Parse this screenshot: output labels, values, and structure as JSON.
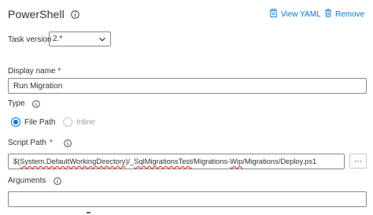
{
  "header": {
    "title": "PowerShell",
    "view_yaml": "View YAML",
    "remove": "Remove"
  },
  "task_version": {
    "label": "Task version",
    "value": "2.*"
  },
  "display_name": {
    "label": "Display name",
    "required_marker": "*",
    "value": "Run Migration"
  },
  "type": {
    "label": "Type",
    "options": [
      {
        "label": "File Path",
        "selected": true
      },
      {
        "label": "Inline",
        "selected": false
      }
    ]
  },
  "script_path": {
    "label": "Script Path",
    "required_marker": "*",
    "value_parts": [
      "$(",
      "System.DefaultWorkingDirectory",
      ")/_",
      "SqlMigrationsTest",
      "/Migrations-",
      "Wip",
      "/Migrations/Deploy.ps1"
    ],
    "browse_label": "···"
  },
  "arguments": {
    "label": "Arguments",
    "value": ""
  },
  "colors": {
    "accent": "#0078d4",
    "required": "#a4262c",
    "border": "#8a8886",
    "text": "#323130"
  },
  "icons": {
    "info": "info-icon",
    "view_yaml": "clipboard-icon",
    "remove": "trash-icon",
    "dropdown": "chevron-down-icon"
  }
}
